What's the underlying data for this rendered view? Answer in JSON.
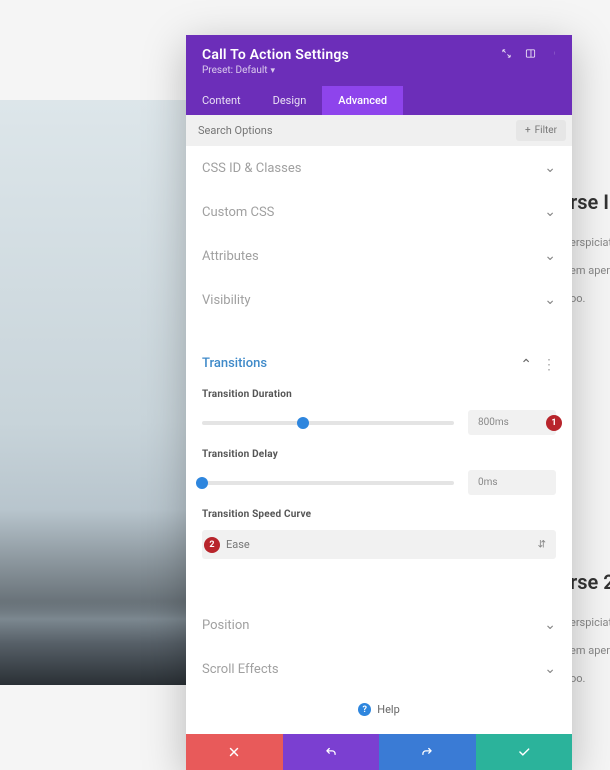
{
  "header": {
    "title": "Call To Action Settings",
    "preset_label": "Preset: Default"
  },
  "tabs": {
    "content": "Content",
    "design": "Design",
    "advanced": "Advanced"
  },
  "search": {
    "placeholder": "Search Options",
    "filter_label": "Filter"
  },
  "sections": {
    "css_id": "CSS ID & Classes",
    "custom_css": "Custom CSS",
    "attributes": "Attributes",
    "visibility": "Visibility",
    "transitions": "Transitions",
    "position": "Position",
    "scroll": "Scroll Effects"
  },
  "transitions": {
    "duration_label": "Transition Duration",
    "duration_value": "800ms",
    "duration_pct": 40,
    "delay_label": "Transition Delay",
    "delay_value": "0ms",
    "delay_pct": 0,
    "speed_label": "Transition Speed Curve",
    "speed_value": "Ease"
  },
  "markers": {
    "m1": "1",
    "m2": "2"
  },
  "help": {
    "label": "Help"
  },
  "background_text": {
    "h1": "rse I",
    "p1": "erspiciati",
    "p2": "em aperi",
    "p3": "oo.",
    "h2": "rse 2",
    "p4": "erspiciati",
    "p5": "em aperi",
    "p6": "oo."
  }
}
